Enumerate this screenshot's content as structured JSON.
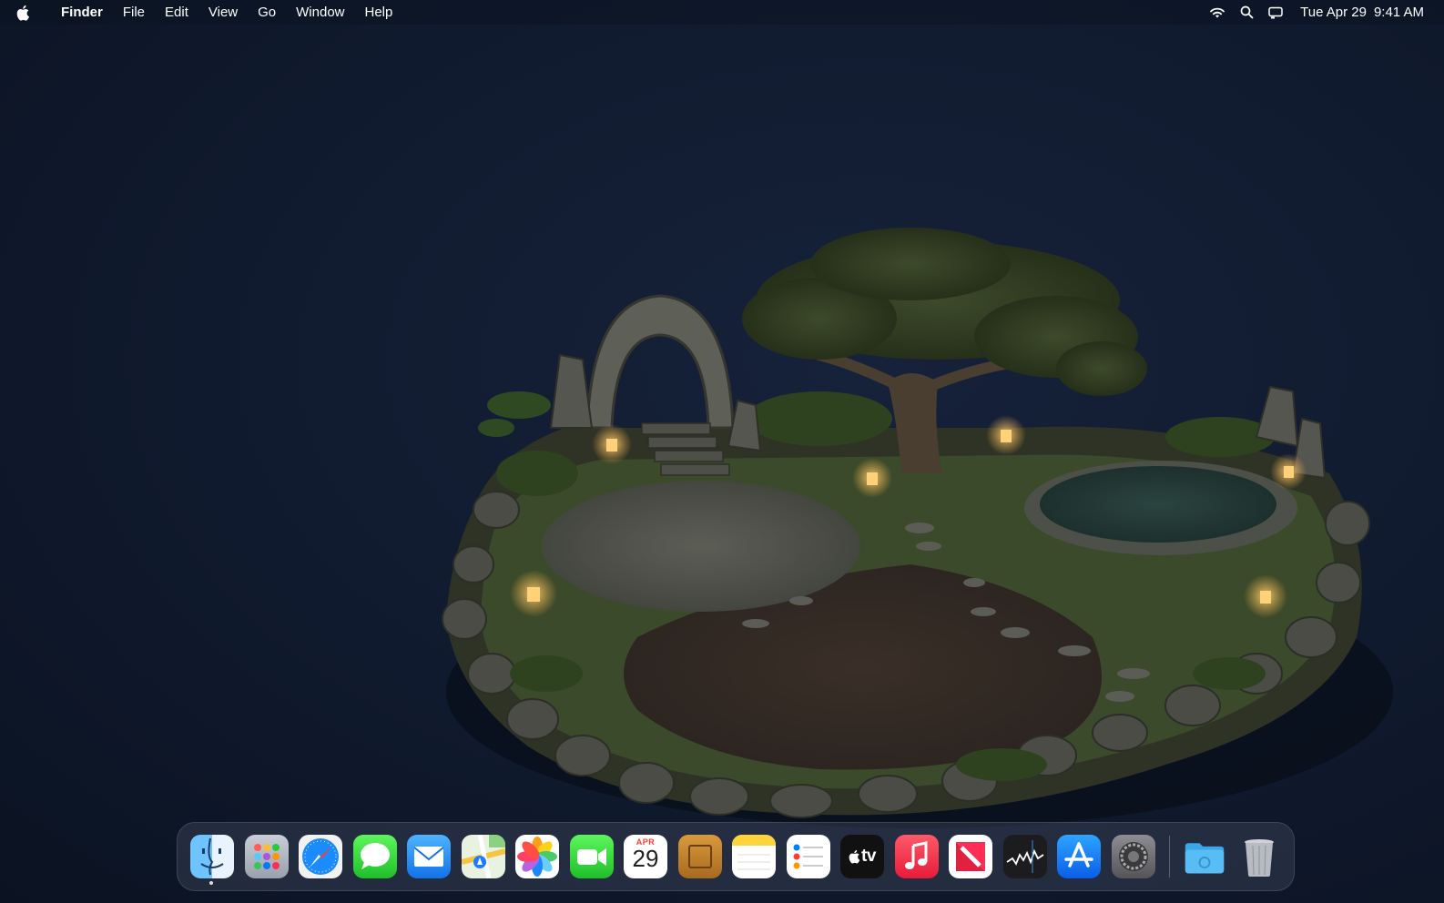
{
  "menubar": {
    "app_name": "Finder",
    "items": [
      "File",
      "Edit",
      "View",
      "Go",
      "Window",
      "Help"
    ],
    "status_icons": [
      "wifi-icon",
      "search-icon",
      "control-center-icon"
    ],
    "date": "Tue Apr 29",
    "time": "9:41 AM"
  },
  "wallpaper": {
    "description_icon": "garden-wallpaper"
  },
  "dock": {
    "apps": [
      {
        "id": "finder",
        "icon": "finder-icon",
        "running": true
      },
      {
        "id": "launchpad",
        "icon": "launchpad-icon"
      },
      {
        "id": "safari",
        "icon": "safari-icon"
      },
      {
        "id": "messages",
        "icon": "messages-icon"
      },
      {
        "id": "mail",
        "icon": "mail-icon"
      },
      {
        "id": "maps",
        "icon": "maps-icon"
      },
      {
        "id": "photos",
        "icon": "photos-icon"
      },
      {
        "id": "facetime",
        "icon": "facetime-icon"
      },
      {
        "id": "calendar",
        "icon": "calendar-icon"
      },
      {
        "id": "notebook",
        "icon": "notebook-icon"
      },
      {
        "id": "notes",
        "icon": "notes-icon"
      },
      {
        "id": "reminders",
        "icon": "reminders-icon"
      },
      {
        "id": "tv",
        "icon": "tv-icon"
      },
      {
        "id": "music",
        "icon": "music-icon"
      },
      {
        "id": "news",
        "icon": "news-icon"
      },
      {
        "id": "stocks",
        "icon": "stocks-icon"
      },
      {
        "id": "app-store",
        "icon": "app-store-icon"
      },
      {
        "id": "system-settings",
        "icon": "settings-icon"
      }
    ],
    "calendar": {
      "month": "APR",
      "day": "29"
    },
    "tv_label": "tv",
    "extras": [
      {
        "id": "downloads-folder",
        "icon": "folder-icon"
      },
      {
        "id": "trash",
        "icon": "trash-icon"
      }
    ]
  },
  "colors": {
    "background": "#101a2e",
    "menubar_text": "#ffffff",
    "calendar_accent": "#ff3b30"
  }
}
